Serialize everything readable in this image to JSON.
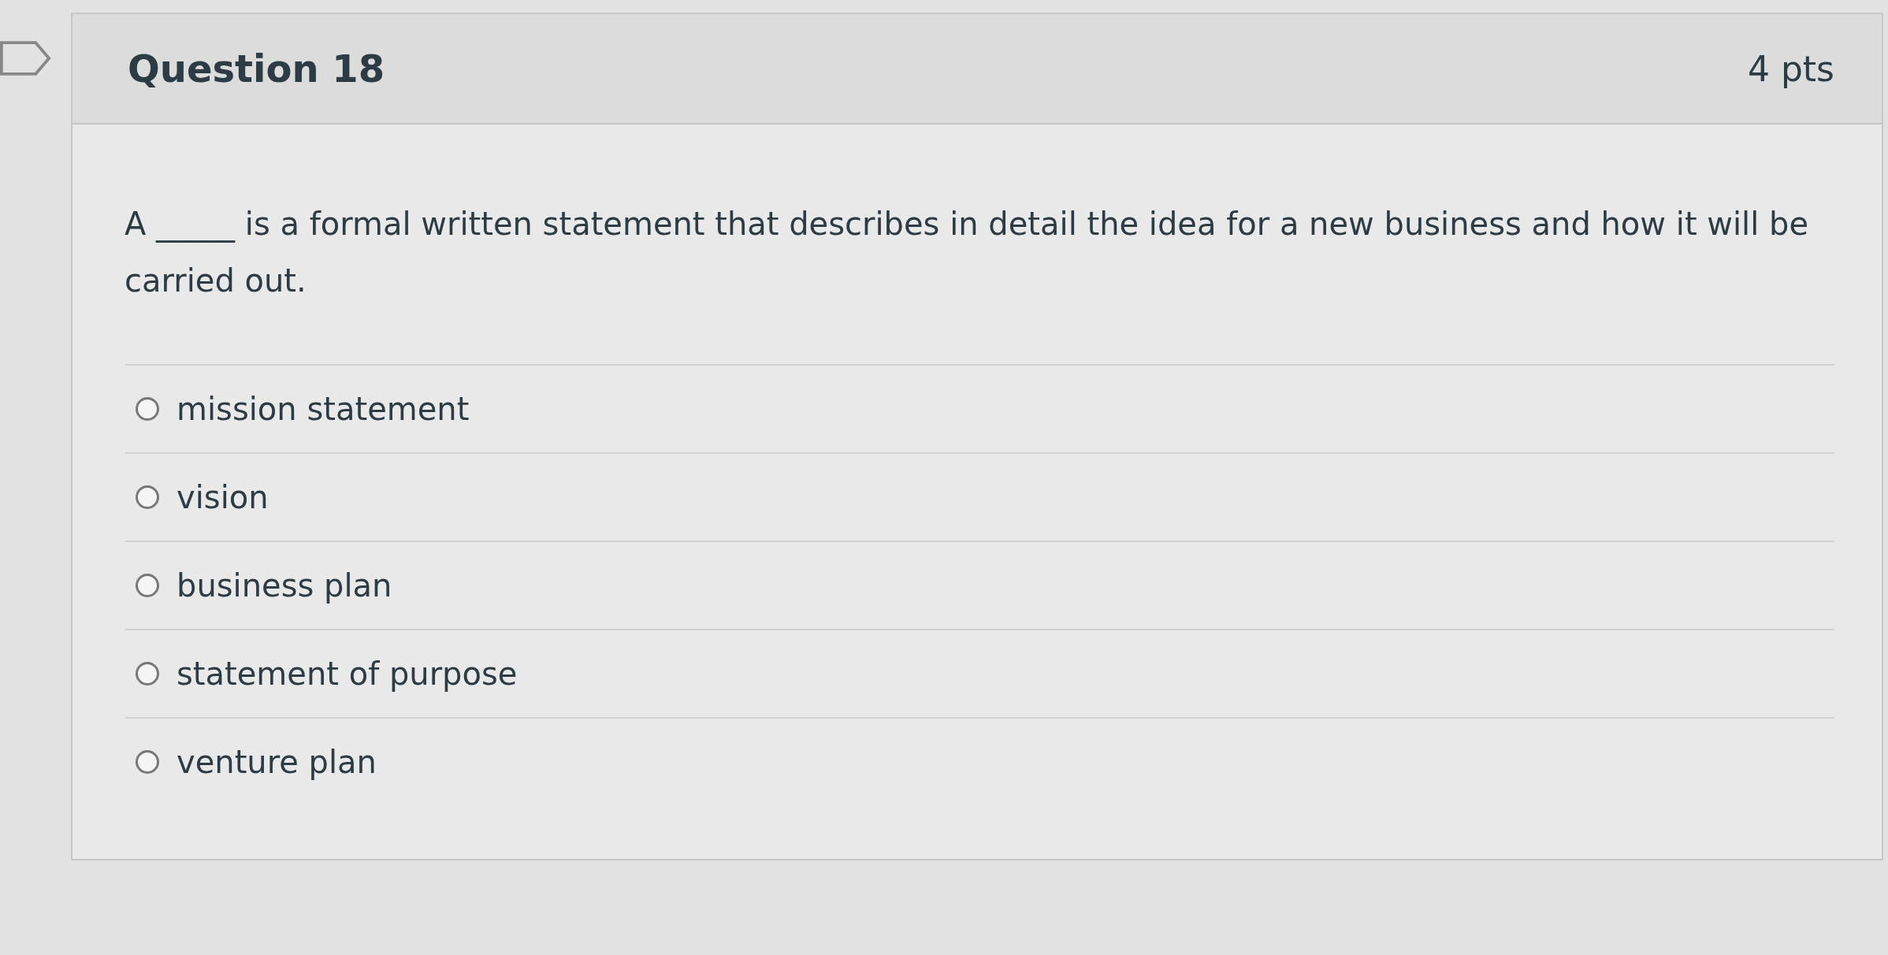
{
  "question": {
    "title": "Question 18",
    "points": "4 pts",
    "text": "A _____ is a formal written statement that describes in detail the idea for a new business and how it will be carried out.",
    "options": [
      {
        "label": "mission statement",
        "selected": false
      },
      {
        "label": "vision",
        "selected": false
      },
      {
        "label": "business plan",
        "selected": false
      },
      {
        "label": "statement of purpose",
        "selected": false
      },
      {
        "label": "venture plan",
        "selected": false
      }
    ]
  }
}
